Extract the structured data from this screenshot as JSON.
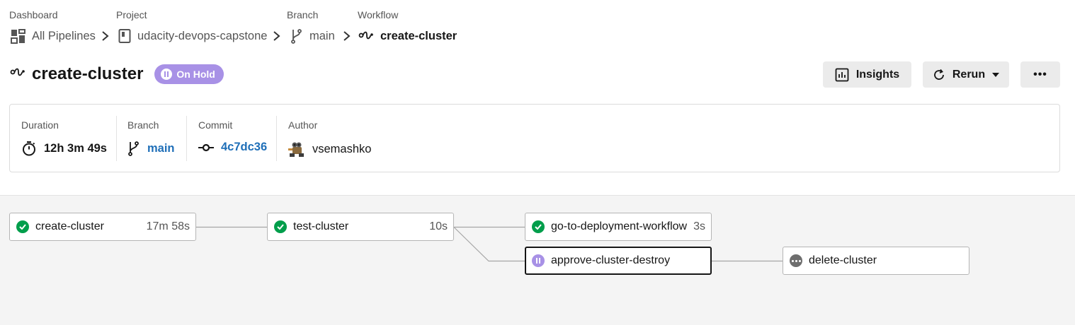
{
  "breadcrumb": {
    "dashboard": {
      "label": "Dashboard",
      "value": "All Pipelines",
      "icon": "dashboard-grid-icon"
    },
    "project": {
      "label": "Project",
      "value": "udacity-devops-capstone",
      "icon": "repo-icon"
    },
    "branch": {
      "label": "Branch",
      "value": "main",
      "icon": "git-branch-icon"
    },
    "workflow": {
      "label": "Workflow",
      "value": "create-cluster",
      "icon": "workflow-icon"
    }
  },
  "header": {
    "title": "create-cluster",
    "status": "On Hold",
    "insights_label": "Insights",
    "rerun_label": "Rerun",
    "more_label": "•••"
  },
  "summary": {
    "duration": {
      "label": "Duration",
      "value": "12h 3m 49s"
    },
    "branch": {
      "label": "Branch",
      "value": "main"
    },
    "commit": {
      "label": "Commit",
      "value": "4c7dc36"
    },
    "author": {
      "label": "Author",
      "value": "vsemashko"
    }
  },
  "jobs": [
    {
      "name": "create-cluster",
      "duration": "17m 58s",
      "status": "success"
    },
    {
      "name": "test-cluster",
      "duration": "10s",
      "status": "success"
    },
    {
      "name": "go-to-deployment-workflow",
      "duration": "3s",
      "status": "success"
    },
    {
      "name": "approve-cluster-destroy",
      "duration": "",
      "status": "on-hold"
    },
    {
      "name": "delete-cluster",
      "duration": "",
      "status": "blocked"
    }
  ],
  "colors": {
    "success": "#009e4b",
    "on_hold": "#a891e6",
    "link": "#1f6fb8",
    "blocked": "#6e6e6e"
  }
}
